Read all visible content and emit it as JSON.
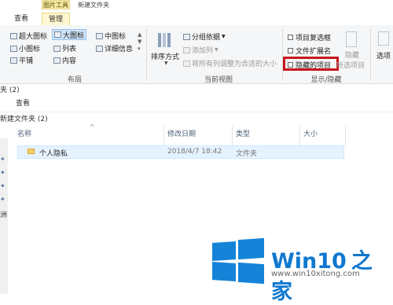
{
  "window": {
    "context_tab": "图片工具",
    "title": "新建文件夹"
  },
  "tabs": {
    "view": "查看",
    "manage": "管理"
  },
  "ribbon": {
    "layout": {
      "items": [
        "超大图标",
        "大图标",
        "中图标",
        "小图标",
        "列表",
        "详细信息",
        "平铺",
        "内容"
      ],
      "label": "布局"
    },
    "current_view": {
      "sort_label": "排序方式",
      "group_by": "分组依据",
      "add_column": "添加列",
      "fit_columns": "将所有列调整为合适的大小",
      "label": "当前视图"
    },
    "show_hide": {
      "item_checkboxes": "项目复选框",
      "file_extensions": "文件扩展名",
      "hidden_items": "隐藏的项目",
      "hide_selected_1": "隐藏",
      "hide_selected_2": "所选项目",
      "label": "显示/隐藏"
    },
    "options_label": "选项"
  },
  "path_fragment": "夹 (2)",
  "sub_tab": "查看",
  "folder_title": "新建文件夹 (2)",
  "columns": {
    "name": "名称",
    "modified": "修改日期",
    "type": "类型",
    "size": "大小"
  },
  "rows": [
    {
      "name": "个人隐私",
      "modified": "2018/4/7 18:42",
      "type": "文件夹",
      "size": ""
    }
  ],
  "watermark": {
    "brand_a": "Win10",
    "brand_b": "之家",
    "url": "www.win10xitong.com",
    "color": "#1584d8"
  }
}
